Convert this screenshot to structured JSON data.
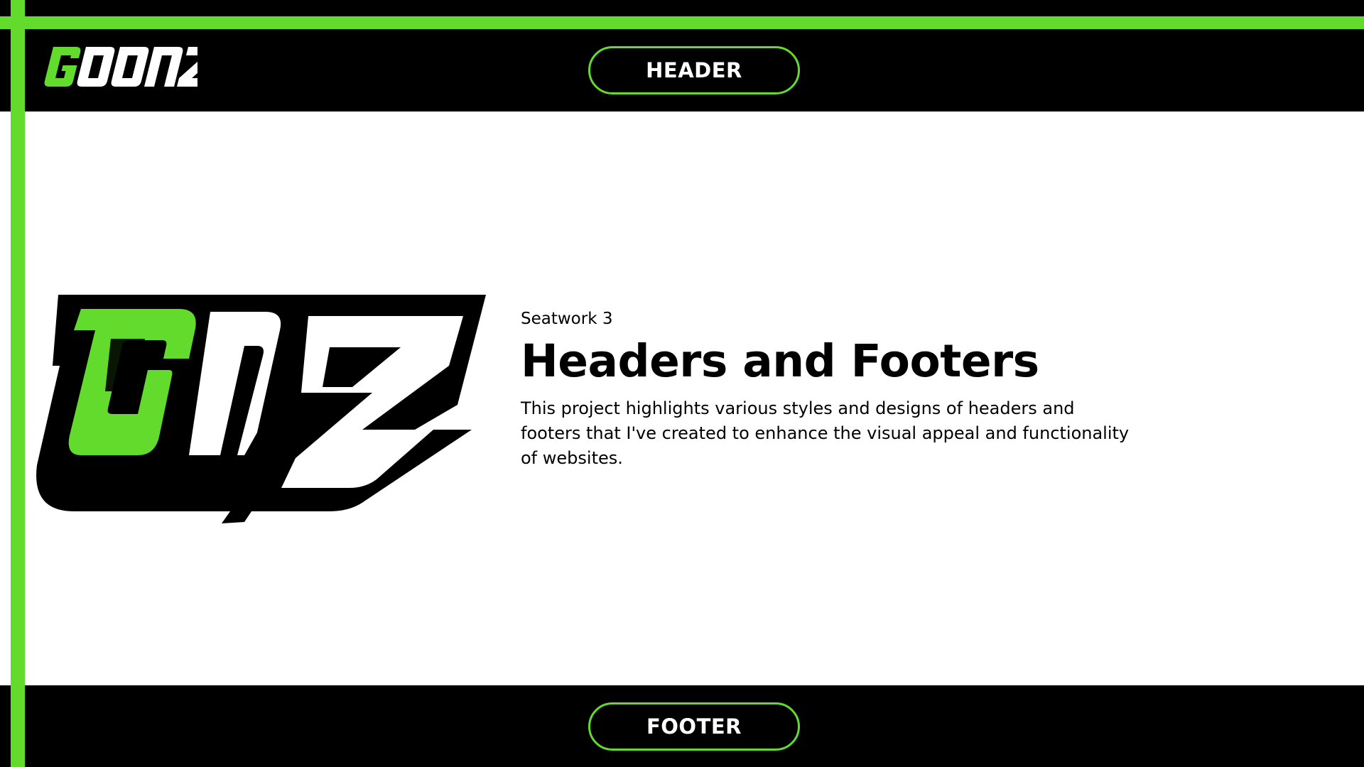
{
  "brand": {
    "logo_text": "GOONZ",
    "hero_logo_text": "GNZ",
    "accent_color": "#62db2d",
    "dark_color": "#000000"
  },
  "header": {
    "button_label": "HEADER"
  },
  "hero": {
    "subtitle": "Seatwork 3",
    "title": "Headers and Footers",
    "description": "This project highlights various styles and designs of headers and footers that I've created to enhance the visual appeal and functionality of websites."
  },
  "footer": {
    "button_label": "FOOTER"
  }
}
